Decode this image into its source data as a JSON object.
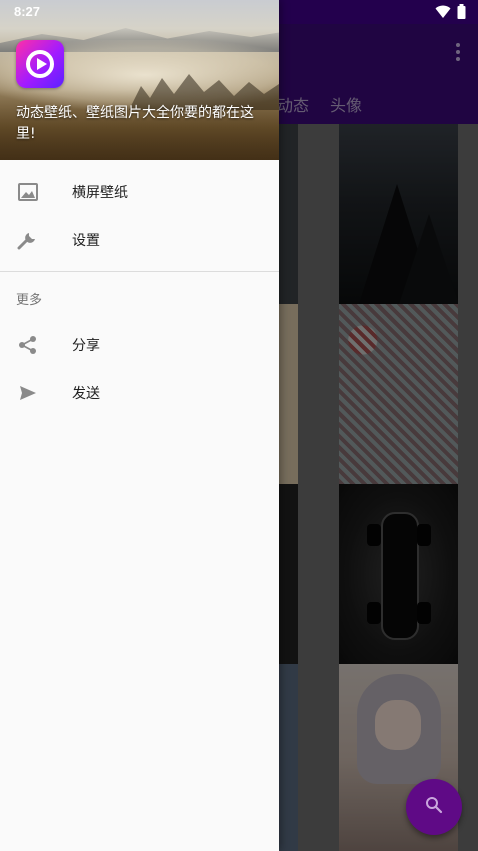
{
  "status_bar": {
    "time": "8:27",
    "icons": [
      "wifi-icon",
      "battery-icon"
    ]
  },
  "app_bar": {
    "tabs": [
      "动态",
      "头像"
    ],
    "overflow_icon": "more-vert-icon",
    "color": "#3b0a78"
  },
  "drawer": {
    "header_text": "动态壁纸、壁纸图片大全你要的都在这里!",
    "logo_icon": "play-logo-icon",
    "main_items": [
      {
        "label": "横屏壁纸",
        "icon": "image-icon"
      },
      {
        "label": "设置",
        "icon": "wrench-icon"
      }
    ],
    "section_title": "更多",
    "more_items": [
      {
        "label": "分享",
        "icon": "share-icon"
      },
      {
        "label": "发送",
        "icon": "send-icon"
      }
    ]
  },
  "fab": {
    "icon": "search-icon",
    "color": "#5f0a86"
  },
  "colors": {
    "accent": "#5f0a86",
    "drawer_bg": "#fafafa",
    "icon_gray": "#8a8a8a"
  }
}
